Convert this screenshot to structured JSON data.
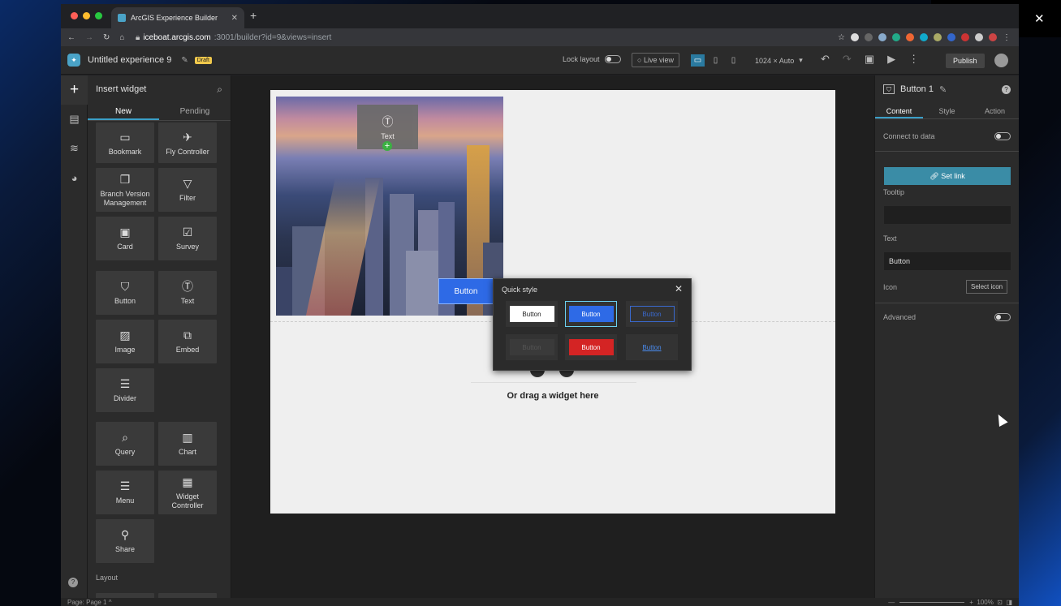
{
  "browser": {
    "tab_title": "ArcGIS Experience Builder",
    "url_host": "iceboat.arcgis.com",
    "url_path": ":3001/builder?id=9&views=insert",
    "colors": {
      "tab_favicon": "#4aa3c7"
    }
  },
  "app": {
    "title": "Untitled experience 9",
    "draft_badge": "Draft",
    "lock_layout": "Lock layout",
    "live_view": "Live view",
    "resolution": "1024 × Auto",
    "publish": "Publish"
  },
  "insert_panel": {
    "title": "Insert widget",
    "tabs": [
      "New",
      "Pending"
    ],
    "widgets": [
      {
        "label": "Bookmark",
        "icon": "bookmark-icon"
      },
      {
        "label": "Fly Controller",
        "icon": "fly-icon"
      },
      {
        "label": "Branch Version Management",
        "icon": "branch-icon"
      },
      {
        "label": "Filter",
        "icon": "filter-icon"
      },
      {
        "label": "Card",
        "icon": "card-icon"
      },
      {
        "label": "Survey",
        "icon": "survey-icon"
      },
      {
        "label": "Button",
        "icon": "button-icon"
      },
      {
        "label": "Text",
        "icon": "text-icon"
      },
      {
        "label": "Image",
        "icon": "image-icon"
      },
      {
        "label": "Embed",
        "icon": "embed-icon"
      },
      {
        "label": "Divider",
        "icon": "divider-icon"
      },
      {
        "label": "Query",
        "icon": "query-icon"
      },
      {
        "label": "Chart",
        "icon": "chart-icon"
      },
      {
        "label": "Menu",
        "icon": "menu-icon"
      },
      {
        "label": "Widget Controller",
        "icon": "widget-controller-icon"
      },
      {
        "label": "Share",
        "icon": "share-icon"
      }
    ],
    "layout_label": "Layout"
  },
  "canvas": {
    "drag_tile_label": "Text",
    "button_label": "Button",
    "drop_hint": "Or drag a widget here"
  },
  "quick_style": {
    "title": "Quick style",
    "buttons": [
      {
        "label": "Button",
        "variant": "default",
        "bg": "#ffffff",
        "fg": "#222222"
      },
      {
        "label": "Button",
        "variant": "primary",
        "bg": "#2e6ae6",
        "fg": "#ffffff",
        "selected": true
      },
      {
        "label": "Button",
        "variant": "outline",
        "bg": "transparent",
        "fg": "#3a6acf"
      },
      {
        "label": "Button",
        "variant": "disabled",
        "bg": "#3a3a3a",
        "fg": "#555555"
      },
      {
        "label": "Button",
        "variant": "danger",
        "bg": "#d42424",
        "fg": "#ffffff"
      },
      {
        "label": "Button",
        "variant": "link",
        "bg": "transparent",
        "fg": "#4a8cf0"
      }
    ]
  },
  "settings_panel": {
    "title": "Button 1",
    "tabs": [
      "Content",
      "Style",
      "Action"
    ],
    "connect_to_data": "Connect to data",
    "set_link": "Set link",
    "tooltip_label": "Tooltip",
    "tooltip_value": "",
    "text_label": "Text",
    "text_value": "Button",
    "icon_label": "Icon",
    "select_icon": "Select icon",
    "advanced": "Advanced"
  },
  "status": {
    "page_label": "Page:",
    "page_value": "Page 1",
    "zoom": "100%"
  }
}
